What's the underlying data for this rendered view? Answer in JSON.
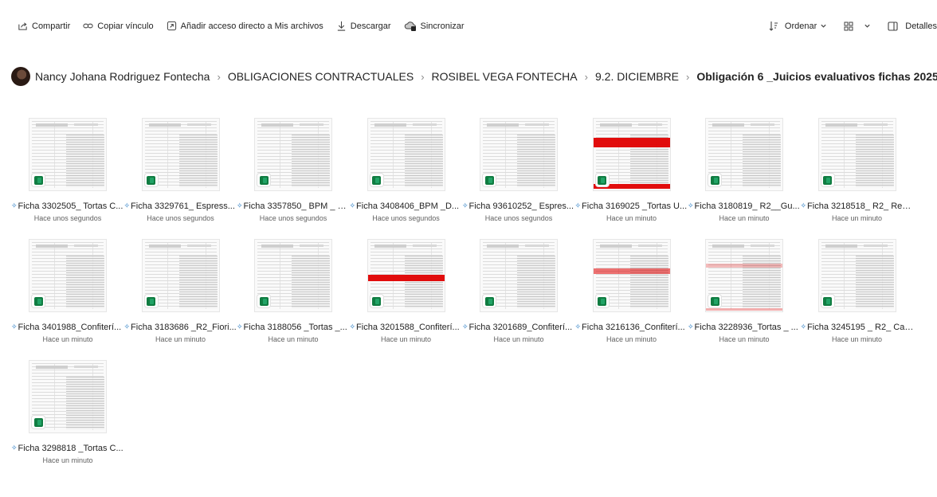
{
  "toolbar": {
    "share": "Compartir",
    "copy_link": "Copiar vínculo",
    "add_shortcut": "Añadir acceso directo a Mis archivos",
    "download": "Descargar",
    "sync": "Sincronizar",
    "sort": "Ordenar",
    "details": "Detalles"
  },
  "breadcrumb": {
    "items": [
      "Nancy Johana Rodriguez Fontecha",
      "OBLIGACIONES CONTRACTUALES",
      "ROSIBEL VEGA FONTECHA",
      "9.2. DICIEMBRE"
    ],
    "current": "Obligación 6 _Juicios evaluativos fichas 2025"
  },
  "files": [
    {
      "name": "Ficha 3302505_ Tortas C...",
      "time": "Hace unos segundos",
      "mark": "none"
    },
    {
      "name": "Ficha 3329761_ Espress...",
      "time": "Hace unos segundos",
      "mark": "none"
    },
    {
      "name": "Ficha 3357850_ BPM _ V...",
      "time": "Hace unos segundos",
      "mark": "none"
    },
    {
      "name": "Ficha 3408406_BPM _D...",
      "time": "Hace unos segundos",
      "mark": "none"
    },
    {
      "name": "Ficha 93610252_ Espres...",
      "time": "Hace unos segundos",
      "mark": "none"
    },
    {
      "name": "Ficha 3169025 _Tortas U...",
      "time": "Hace un minuto",
      "mark": "red-top"
    },
    {
      "name": "Ficha 3180819_ R2__Gu...",
      "time": "Hace un minuto",
      "mark": "none"
    },
    {
      "name": "Ficha 3218518_ R2_ Rec...",
      "time": "Hace un minuto",
      "mark": "none"
    },
    {
      "name": "Ficha 3401988_Confiterí...",
      "time": "Hace un minuto",
      "mark": "none"
    },
    {
      "name": "Ficha 3183686 _R2_Fiori...",
      "time": "Hace un minuto",
      "mark": "none"
    },
    {
      "name": "Ficha 3188056 _Tortas _...",
      "time": "Hace un minuto",
      "mark": "none"
    },
    {
      "name": "Ficha 3201588_Confiterí...",
      "time": "Hace un minuto",
      "mark": "red-mid"
    },
    {
      "name": "Ficha 3201689_Confiterí...",
      "time": "Hace un minuto",
      "mark": "none"
    },
    {
      "name": "Ficha 3216136_Confiterí...",
      "time": "Hace un minuto",
      "mark": "pink-mid"
    },
    {
      "name": "Ficha 3228936_Tortas _ ...",
      "time": "Hace un minuto",
      "mark": "pink-light"
    },
    {
      "name": "Ficha 3245195 _ R2_ Caf...",
      "time": "Hace un minuto",
      "mark": "none"
    },
    {
      "name": "Ficha 3298818 _Tortas C...",
      "time": "Hace un minuto",
      "mark": "none"
    }
  ],
  "new_indicator": "✧",
  "colors": {
    "excel_green": "#107c41",
    "link_blue": "#0f6cbd",
    "mark_red": "#e00000"
  }
}
